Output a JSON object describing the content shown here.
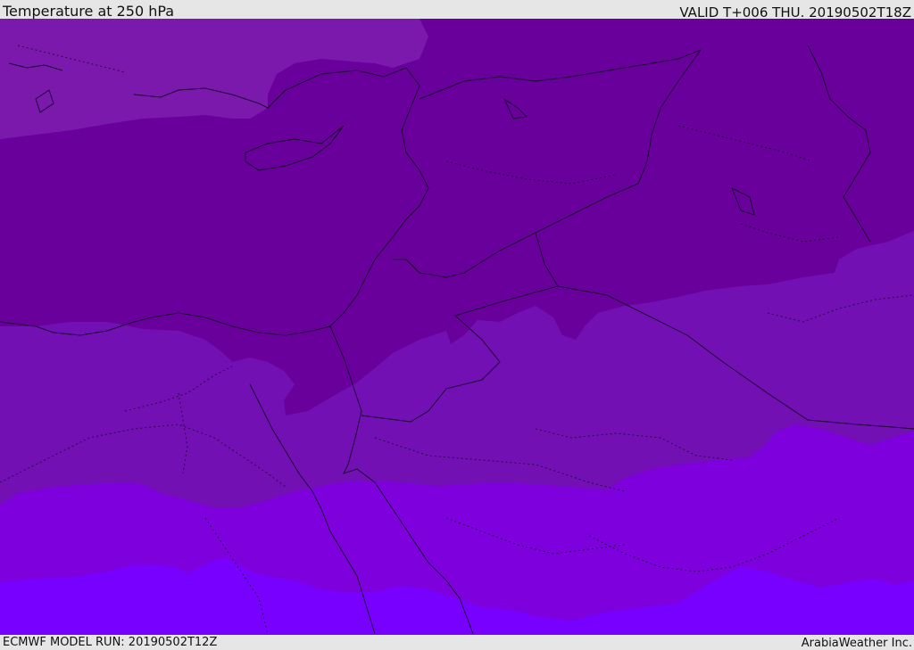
{
  "header": {
    "title": "Temperature at 250 hPa",
    "valid_time": "VALID T+006 THU. 20190502T18Z"
  },
  "footer": {
    "model_run": "ECMWF MODEL RUN: 20190502T12Z",
    "credit": "ArabiaWeather Inc."
  },
  "map": {
    "temperature_band_colors": {
      "warmest": "#7800ff",
      "warm": "#7d00dd",
      "mid": "#7310b4",
      "cool": "#69009b",
      "light_north": "#7b19ad"
    }
  }
}
